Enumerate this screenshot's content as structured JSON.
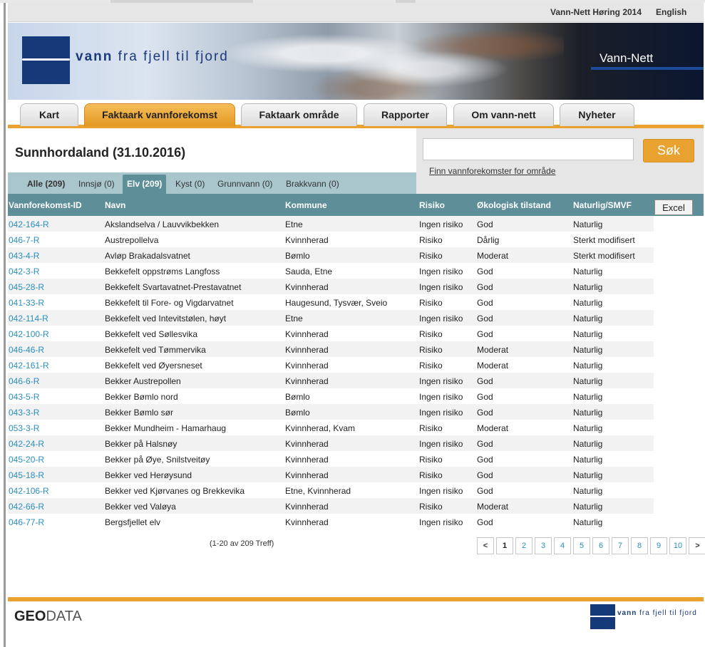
{
  "topbar": {
    "hoering_label": "Vann-Nett Høring 2014",
    "english_label": "English"
  },
  "banner": {
    "tagline_bold": "vann",
    "tagline_rest": " fra fjell til fjord",
    "brand": "Vann-Nett"
  },
  "nav": {
    "tabs": [
      {
        "label": "Kart"
      },
      {
        "label": "Faktaark vannforekomst"
      },
      {
        "label": "Faktaark område"
      },
      {
        "label": "Rapporter"
      },
      {
        "label": "Om vann-nett"
      },
      {
        "label": "Nyheter"
      }
    ]
  },
  "page": {
    "title": "Sunnhordaland (31.10.2016)"
  },
  "search": {
    "placeholder": "",
    "button_label": "Søk",
    "area_link": "Finn vannforekomster for område"
  },
  "filters": [
    {
      "label": "Alle (209)"
    },
    {
      "label": "Innsjø (0)"
    },
    {
      "label": "Elv (209)"
    },
    {
      "label": "Kyst (0)"
    },
    {
      "label": "Grunnvann (0)"
    },
    {
      "label": "Brakkvann (0)"
    }
  ],
  "table": {
    "headers": [
      "Vannforekomst-ID",
      "Navn",
      "Kommune",
      "Risiko",
      "Økologisk tilstand",
      "Naturlig/SMVF"
    ],
    "excel_label": "Excel",
    "rows": [
      [
        "042-164-R",
        "Akslandselva / Lauvvikbekken",
        "Etne",
        "Ingen risiko",
        "God",
        "Naturlig"
      ],
      [
        "046-7-R",
        "Austrepollelva",
        "Kvinnherad",
        "Risiko",
        "Dårlig",
        "Sterkt modifisert"
      ],
      [
        "043-4-R",
        "Avløp Brakadalsvatnet",
        "Bømlo",
        "Risiko",
        "Moderat",
        "Sterkt modifisert"
      ],
      [
        "042-3-R",
        "Bekkefelt oppstrøms Langfoss",
        "Sauda, Etne",
        "Ingen risiko",
        "God",
        "Naturlig"
      ],
      [
        "045-28-R",
        "Bekkefelt Svartavatnet-Prestavatnet",
        "Kvinnherad",
        "Ingen risiko",
        "God",
        "Naturlig"
      ],
      [
        "041-33-R",
        "Bekkefelt til Fore- og Vigdarvatnet",
        "Haugesund, Tysvær, Sveio",
        "Risiko",
        "God",
        "Naturlig"
      ],
      [
        "042-114-R",
        "Bekkefelt ved Intevitstølen, høyt",
        "Etne",
        "Ingen risiko",
        "God",
        "Naturlig"
      ],
      [
        "042-100-R",
        "Bekkefelt ved Søllesvika",
        "Kvinnherad",
        "Risiko",
        "God",
        "Naturlig"
      ],
      [
        "046-46-R",
        "Bekkefelt ved Tømmervika",
        "Kvinnherad",
        "Risiko",
        "Moderat",
        "Naturlig"
      ],
      [
        "042-161-R",
        "Bekkefelt ved Øyersneset",
        "Kvinnherad",
        "Risiko",
        "Moderat",
        "Naturlig"
      ],
      [
        "046-6-R",
        "Bekker Austrepollen",
        "Kvinnherad",
        "Ingen risiko",
        "God",
        "Naturlig"
      ],
      [
        "043-5-R",
        "Bekker Bømlo nord",
        "Bømlo",
        "Ingen risiko",
        "God",
        "Naturlig"
      ],
      [
        "043-3-R",
        "Bekker Bømlo sør",
        "Bømlo",
        "Ingen risiko",
        "God",
        "Naturlig"
      ],
      [
        "053-3-R",
        "Bekker Mundheim - Hamarhaug",
        "Kvinnherad, Kvam",
        "Risiko",
        "Moderat",
        "Naturlig"
      ],
      [
        "042-24-R",
        "Bekker på Halsnøy",
        "Kvinnherad",
        "Ingen risiko",
        "God",
        "Naturlig"
      ],
      [
        "045-20-R",
        "Bekker på Øye, Snilstveitøy",
        "Kvinnherad",
        "Risiko",
        "God",
        "Naturlig"
      ],
      [
        "045-18-R",
        "Bekker ved Herøysund",
        "Kvinnherad",
        "Risiko",
        "God",
        "Naturlig"
      ],
      [
        "042-106-R",
        "Bekker ved Kjørvanes og Brekkevika",
        "Etne, Kvinnherad",
        "Ingen risiko",
        "God",
        "Naturlig"
      ],
      [
        "042-66-R",
        "Bekker ved Valøya",
        "Kvinnherad",
        "Risiko",
        "Moderat",
        "Naturlig"
      ],
      [
        "046-77-R",
        "Bergsfjellet elv",
        "Kvinnherad",
        "Ingen risiko",
        "God",
        "Naturlig"
      ]
    ],
    "count_text": "(1-20 av 209 Treff)"
  },
  "pager": {
    "prev": "<",
    "next": ">",
    "pages": [
      "1",
      "2",
      "3",
      "4",
      "5",
      "6",
      "7",
      "8",
      "9",
      "10"
    ],
    "current": "1"
  },
  "footer": {
    "geodata_bold": "GEO",
    "geodata_rest": "DATA",
    "tagline_bold": "vann",
    "tagline_rest": " fra fjell til fjord"
  },
  "colors": {
    "accent": "#e9a230",
    "table_header": "#5e8e98",
    "filter_bar": "#a9c6cd",
    "link": "#2a8fbf",
    "brand_blue": "#16397a"
  }
}
